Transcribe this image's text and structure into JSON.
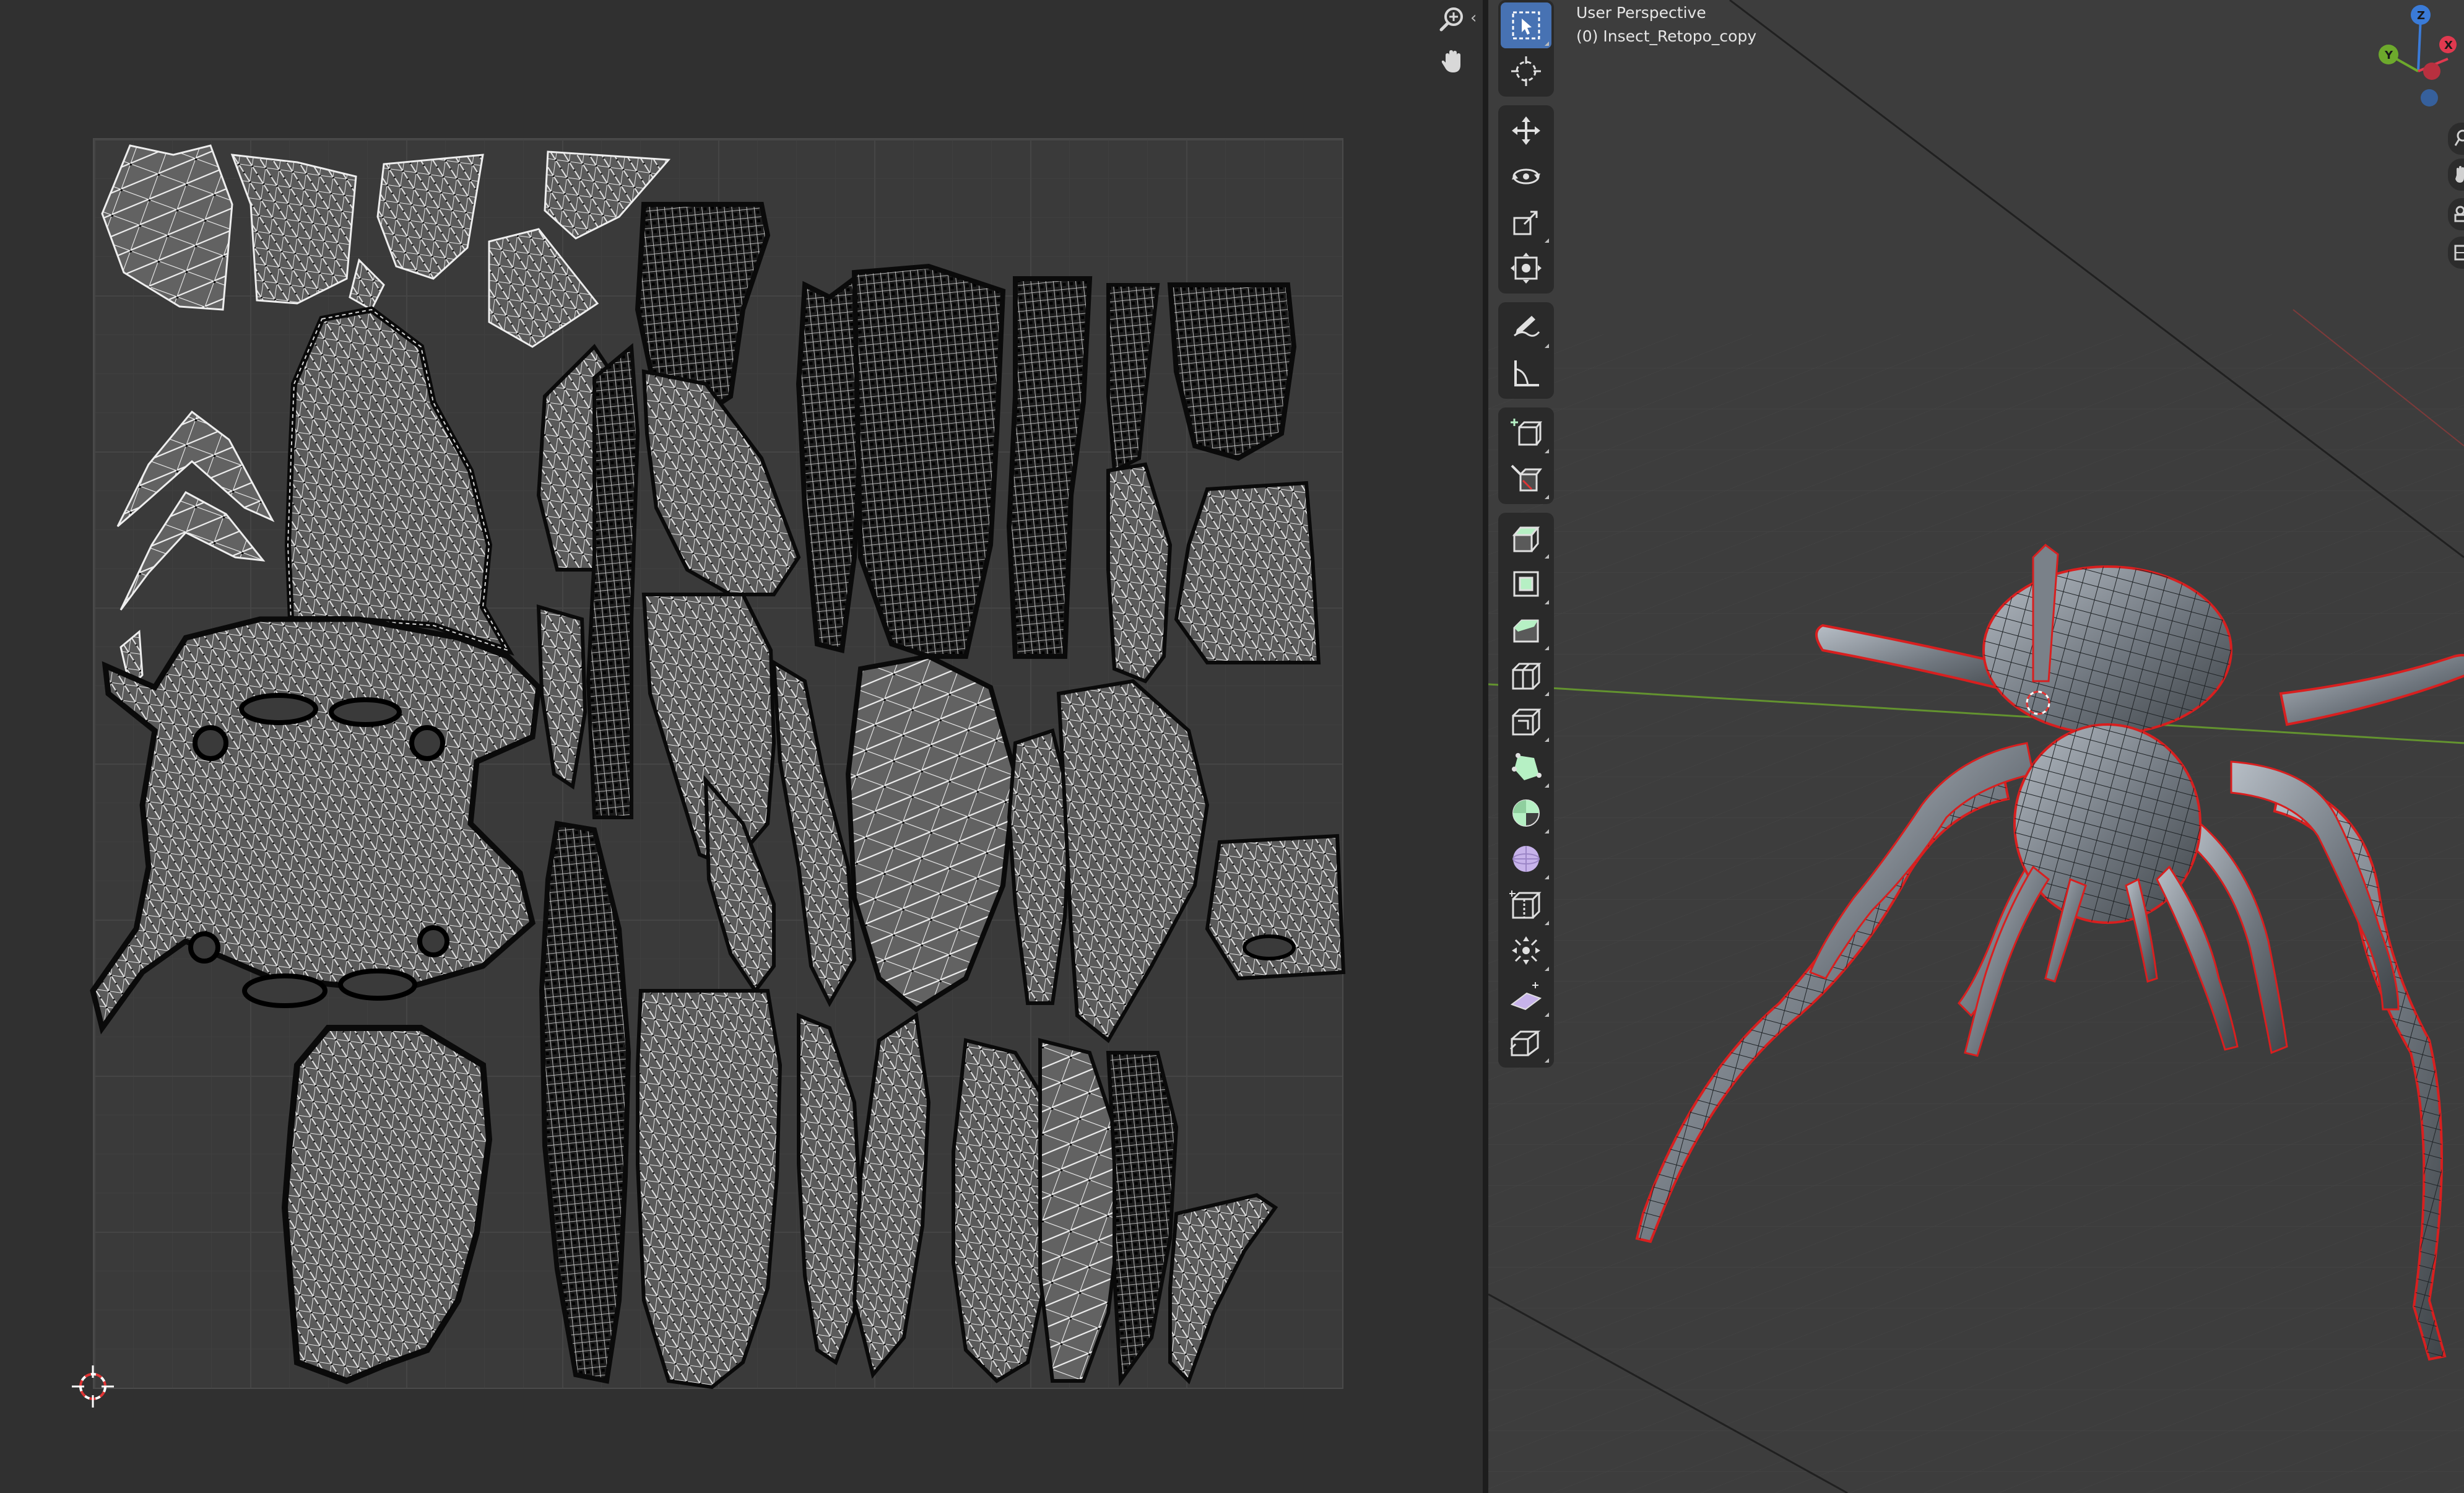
{
  "viewport": {
    "perspective_label": "User Perspective",
    "object_label": "(0) Insect_Retopo_copy"
  },
  "gizmo": {
    "z_label": "Z",
    "y_label": "Y",
    "x_label": "X"
  },
  "icons": {
    "uv_zoom": "zoom-in-icon",
    "uv_pan": "hand-pan-icon",
    "uv_collapse": "chevron-left-icon",
    "toolbar": [
      "select-box-icon",
      "cursor-icon",
      "move-icon",
      "rotate-icon",
      "scale-icon",
      "transform-icon",
      "annotate-icon",
      "measure-icon",
      "add-cube-icon",
      "knife-cube-icon",
      "extrude-icon",
      "inset-icon",
      "bevel-icon",
      "loop-cut-icon",
      "offset-edge-icon",
      "poly-build-icon",
      "spin-icon",
      "smooth-icon",
      "edge-slide-icon",
      "shrink-fatten-icon",
      "shear-icon",
      "rip-icon"
    ]
  },
  "colors": {
    "active_tool": "#4772b3",
    "x_axis": "#e0394f",
    "y_axis": "#6da92c",
    "z_axis": "#3a7bd8",
    "selection_outline": "#d81f1f"
  }
}
